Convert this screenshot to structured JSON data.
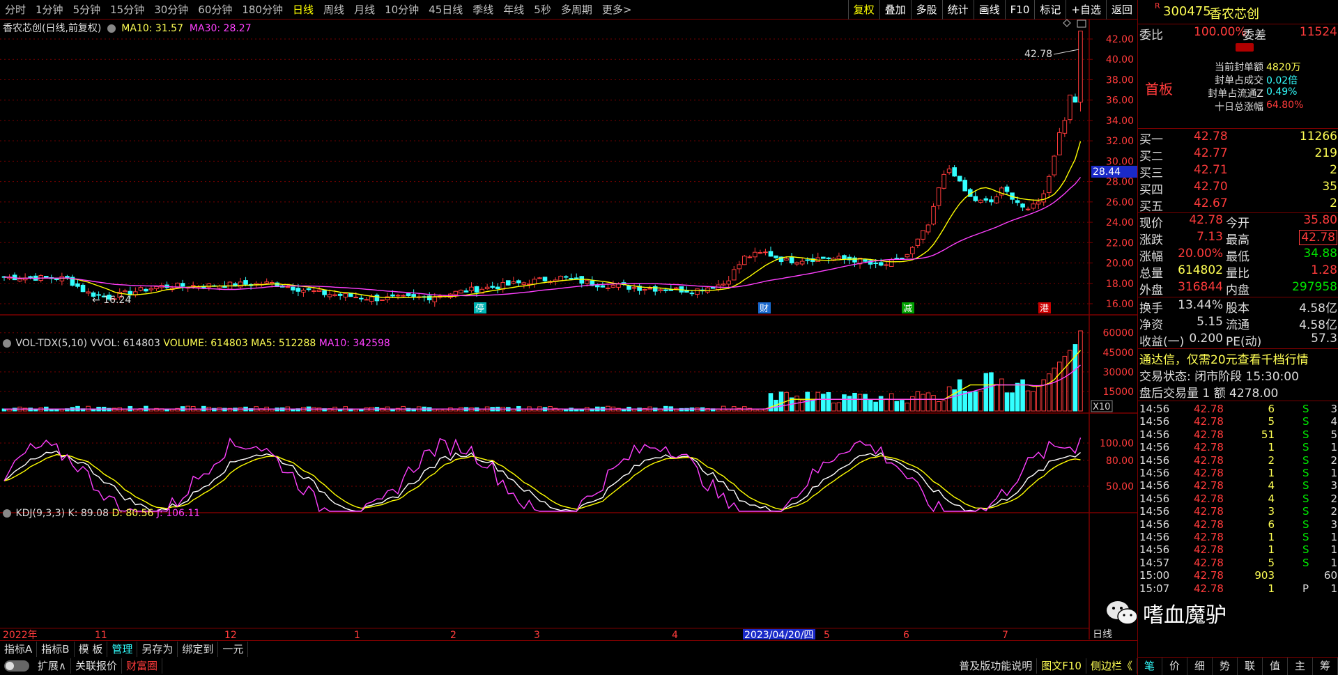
{
  "toolbar": {
    "periods": [
      "分时",
      "1分钟",
      "5分钟",
      "15分钟",
      "30分钟",
      "60分钟",
      "180分钟",
      "日线",
      "周线",
      "月线",
      "10分钟",
      "45日线",
      "季线",
      "年线",
      "5秒",
      "多周期",
      "更多>"
    ],
    "active_period": "日线",
    "right_tools": [
      "复权",
      "叠加",
      "多股",
      "统计",
      "画线",
      "F10",
      "标记",
      "+自选",
      "返回"
    ]
  },
  "main_chart": {
    "title": "香农芯创(日线,前复权)",
    "ma10_label": "MA10: 31.57",
    "ma30_label": "MA30: 28.27",
    "price_ticks": [
      "42.00",
      "40.00",
      "38.00",
      "36.00",
      "34.00",
      "32.00",
      "30.00",
      "28.00",
      "26.00",
      "24.00",
      "22.00",
      "20.00",
      "18.00",
      "16.00"
    ],
    "high_label": "42.78",
    "low_label": "16.24",
    "current_price_tag": "28.44",
    "markers": [
      "停",
      "财",
      "减",
      "港"
    ],
    "colors": {
      "up": "#ff3b3b",
      "down": "#33ffff",
      "ma10": "#ffff00",
      "ma30": "#ff40ff",
      "grid": "#7a0000"
    }
  },
  "volume_chart": {
    "title": "VOL-TDX(5,10)",
    "vvol": "VVOL: 614803",
    "volume": "VOLUME: 614803",
    "ma5": "MA5: 512288",
    "ma10": "MA10: 342598",
    "ticks": [
      "60000",
      "45000",
      "30000",
      "15000"
    ],
    "multiplier": "X10"
  },
  "kdj_chart": {
    "title": "KDJ(9,3,3)",
    "k": "K: 89.08",
    "d": "D: 80.56",
    "j": "J: 106.11",
    "ticks": [
      "100.00",
      "80.00",
      "50.00"
    ]
  },
  "x_axis": {
    "labels": [
      "2022年",
      "11",
      "12",
      "1",
      "2",
      "3",
      "4",
      "2023/04/20/四",
      "5",
      "6",
      "7"
    ],
    "unit": "日线"
  },
  "bottom_bar": {
    "row1": [
      "指标A",
      "指标B",
      "模 板",
      "管理",
      "另存为",
      "绑定到",
      "一元"
    ],
    "active_row1": "管理",
    "row2": [
      "扩展∧",
      "关联报价",
      "财富圈"
    ],
    "right_text": "普及版功能说明",
    "right_link": "图文F10",
    "right_side": "侧边栏《"
  },
  "quote_panel": {
    "code": "300475",
    "name": "香农芯创",
    "r_badge": "R",
    "weibi_label": "委比",
    "weibi": "100.00%",
    "weicha_label": "委差",
    "weicha": "11524",
    "board": "首板",
    "seal_info": [
      {
        "label": "当前封单额",
        "value": "4820万"
      },
      {
        "label": "封单占成交",
        "value": "0.02倍"
      },
      {
        "label": "封单占流通Z",
        "value": "0.49%"
      },
      {
        "label": "十日总涨幅",
        "value": "64.80%"
      }
    ],
    "bids": [
      {
        "label": "买一",
        "price": "42.78",
        "vol": "11266"
      },
      {
        "label": "买二",
        "price": "42.77",
        "vol": "219"
      },
      {
        "label": "买三",
        "price": "42.71",
        "vol": "2"
      },
      {
        "label": "买四",
        "price": "42.70",
        "vol": "35"
      },
      {
        "label": "买五",
        "price": "42.67",
        "vol": "2"
      }
    ],
    "stats": [
      {
        "l1": "现价",
        "v1": "42.78",
        "l2": "今开",
        "v2": "35.80"
      },
      {
        "l1": "涨跌",
        "v1": "7.13",
        "l2": "最高",
        "v2": "42.78"
      },
      {
        "l1": "涨幅",
        "v1": "20.00%",
        "l2": "最低",
        "v2": "34.88"
      },
      {
        "l1": "总量",
        "v1": "614802",
        "l2": "量比",
        "v2": "1.28"
      },
      {
        "l1": "外盘",
        "v1": "316844",
        "l2": "内盘",
        "v2": "297958"
      }
    ],
    "stats2": [
      {
        "l1": "换手",
        "v1": "13.44%",
        "l2": "股本",
        "v2": "4.58亿"
      },
      {
        "l1": "净资",
        "v1": "5.15",
        "l2": "流通",
        "v2": "4.58亿"
      },
      {
        "l1": "收益(一)",
        "v1": "0.200",
        "l2": "PE(动)",
        "v2": "57.3"
      }
    ],
    "promo": "通达信，仅需20元查看千档行情",
    "trade_state": "交易状态: 闭市阶段 15:30:00",
    "after_hours": "盘后交易量 1 额 4278.00",
    "ticks": [
      {
        "t": "14:56",
        "p": "42.78",
        "v": "6",
        "s": "S",
        "n": "3"
      },
      {
        "t": "14:56",
        "p": "42.78",
        "v": "5",
        "s": "S",
        "n": "4"
      },
      {
        "t": "14:56",
        "p": "42.78",
        "v": "51",
        "s": "S",
        "n": "5"
      },
      {
        "t": "14:56",
        "p": "42.78",
        "v": "1",
        "s": "S",
        "n": "1"
      },
      {
        "t": "14:56",
        "p": "42.78",
        "v": "2",
        "s": "S",
        "n": "2"
      },
      {
        "t": "14:56",
        "p": "42.78",
        "v": "1",
        "s": "S",
        "n": "1"
      },
      {
        "t": "14:56",
        "p": "42.78",
        "v": "4",
        "s": "S",
        "n": "3"
      },
      {
        "t": "14:56",
        "p": "42.78",
        "v": "4",
        "s": "S",
        "n": "2"
      },
      {
        "t": "14:56",
        "p": "42.78",
        "v": "3",
        "s": "S",
        "n": "2"
      },
      {
        "t": "14:56",
        "p": "42.78",
        "v": "6",
        "s": "S",
        "n": "3"
      },
      {
        "t": "14:56",
        "p": "42.78",
        "v": "1",
        "s": "S",
        "n": "1"
      },
      {
        "t": "14:56",
        "p": "42.78",
        "v": "1",
        "s": "S",
        "n": "1"
      },
      {
        "t": "14:57",
        "p": "42.78",
        "v": "5",
        "s": "S",
        "n": "1"
      },
      {
        "t": "15:00",
        "p": "42.78",
        "v": "903",
        "s": "",
        "n": "60"
      },
      {
        "t": "15:07",
        "p": "42.78",
        "v": "1",
        "s": "P",
        "n": "1"
      }
    ],
    "tabs": [
      "笔",
      "价",
      "细",
      "势",
      "联",
      "值",
      "主",
      "筹"
    ],
    "active_tab": "笔"
  },
  "watermark": "嗜血魔驴"
}
